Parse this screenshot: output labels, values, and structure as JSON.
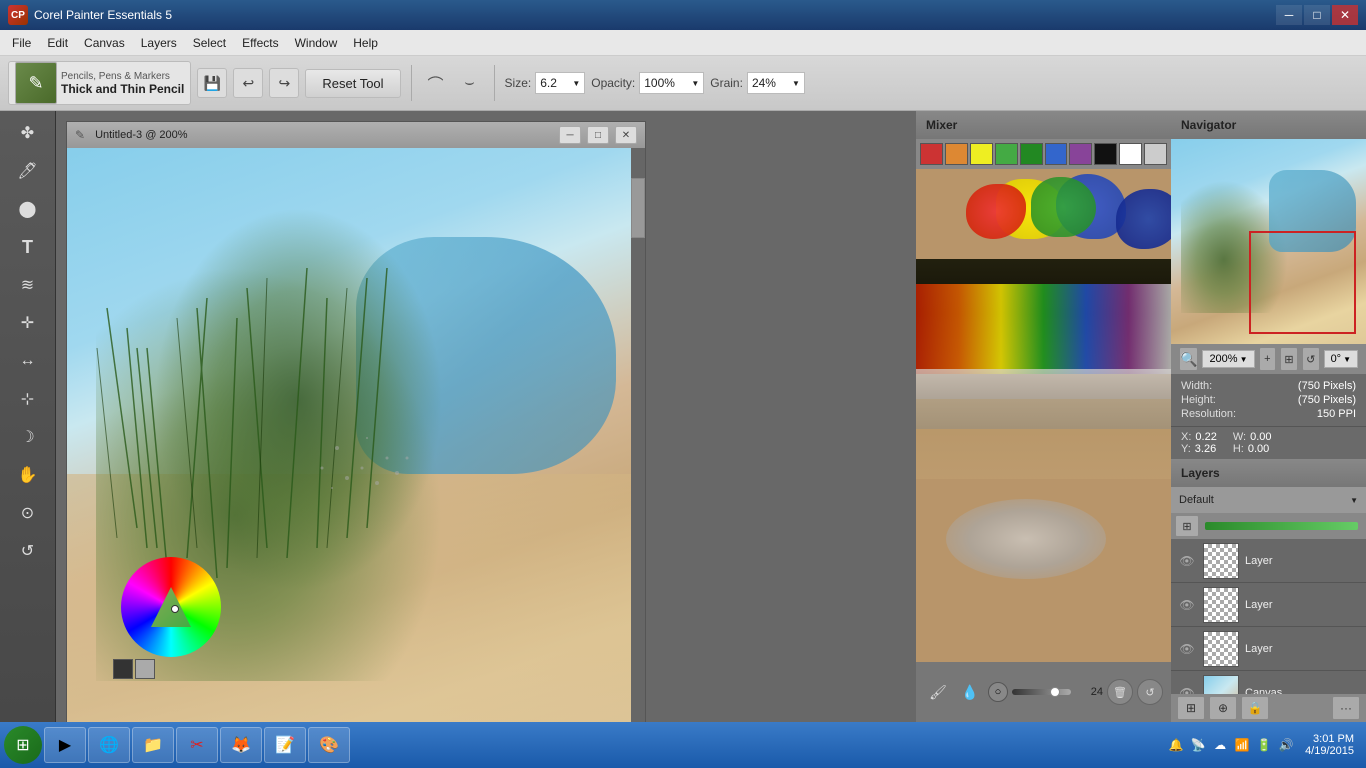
{
  "app": {
    "title": "Corel Painter Essentials 5",
    "icon": "CP"
  },
  "window_controls": {
    "minimize": "─",
    "maximize": "□",
    "close": "✕"
  },
  "menu": {
    "items": [
      "File",
      "Edit",
      "Canvas",
      "Layers",
      "Select",
      "Effects",
      "Window",
      "Help"
    ]
  },
  "toolbar": {
    "tool_category": "Pencils, Pens & Markers",
    "tool_name": "Thick and Thin Pencil",
    "save_label": "💾",
    "undo_label": "↩",
    "redo_label": "↪",
    "reset_tool": "Reset Tool",
    "brush1": "⌒",
    "brush2": "⌣",
    "size_label": "Size:",
    "size_value": "6.2",
    "opacity_label": "Opacity:",
    "opacity_value": "100%",
    "grain_label": "Grain:",
    "grain_value": "24%"
  },
  "document": {
    "title": "Untitled-3 @ 200%"
  },
  "left_tools": {
    "items": [
      "✎",
      "◈",
      "⬤",
      "T",
      "≋",
      "⊕",
      "↔",
      "✛",
      "☽",
      "✋",
      "⊙",
      "↺"
    ]
  },
  "mixer": {
    "title": "Mixer",
    "colors": [
      "#cc3333",
      "#dd8833",
      "#eeee22",
      "#44aa44",
      "#339944",
      "#3366cc",
      "#884499",
      "#111111",
      "#ffffff",
      "#cccccc"
    ],
    "size_value": "24",
    "trash_icon": "🗑",
    "brush_icon": "🖌"
  },
  "layers": {
    "title": "Layers",
    "default_label": "Default",
    "items": [
      {
        "name": "Laye",
        "visible": true,
        "type": "transparent"
      },
      {
        "name": "Laye",
        "visible": true,
        "type": "transparent"
      },
      {
        "name": "Laye",
        "visible": true,
        "type": "transparent"
      },
      {
        "name": "Canv",
        "visible": true,
        "type": "canvas"
      }
    ],
    "add_icon": "+",
    "delete_icon": "🗑",
    "lock_icon": "🔒"
  },
  "navigator": {
    "title": "Navigator",
    "zoom_value": "200%",
    "angle_value": "0°",
    "width_label": "Width:",
    "width_value": "(750 Pixels)",
    "height_label": "Height:",
    "height_value": "(750 Pixels)",
    "resolution_label": "Resolution:",
    "resolution_value": "150 PPI",
    "x_label": "X:",
    "x_value": "0.22",
    "y_label": "Y:",
    "y_value": "3.26",
    "w_label": "W:",
    "w_value": "0.00",
    "h_label": "H:",
    "h_value": "0.00"
  },
  "taskbar": {
    "start_icon": "⊞",
    "clock": "3:01 PM",
    "date": "4/19/2015",
    "tray_icons": [
      "🔊",
      "🌐",
      "🔋"
    ]
  }
}
